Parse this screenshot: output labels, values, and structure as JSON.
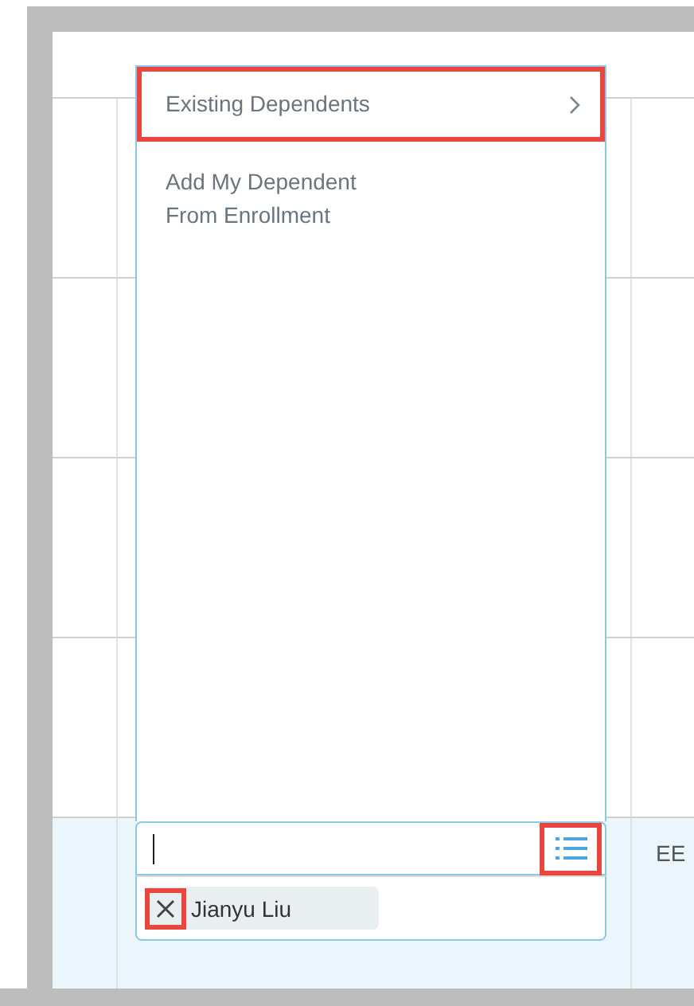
{
  "table": {
    "rows": [
      {
        "selected": false,
        "cells": []
      },
      {
        "selected": false,
        "cells": []
      },
      {
        "selected": false,
        "cells": []
      },
      {
        "selected": false,
        "cells": []
      },
      {
        "selected": true,
        "cells": [
          "EE"
        ]
      }
    ]
  },
  "menu": {
    "items": [
      {
        "label": "Existing Dependents",
        "has_submenu": true,
        "highlighted": true
      },
      {
        "label": "Add My Dependent\nFrom Enrollment",
        "has_submenu": false,
        "highlighted": false
      }
    ]
  },
  "prompt_field": {
    "list_button_highlighted": true
  },
  "selected_items": [
    {
      "label": "Jianyu Liu",
      "remove_highlighted": true
    }
  ]
}
